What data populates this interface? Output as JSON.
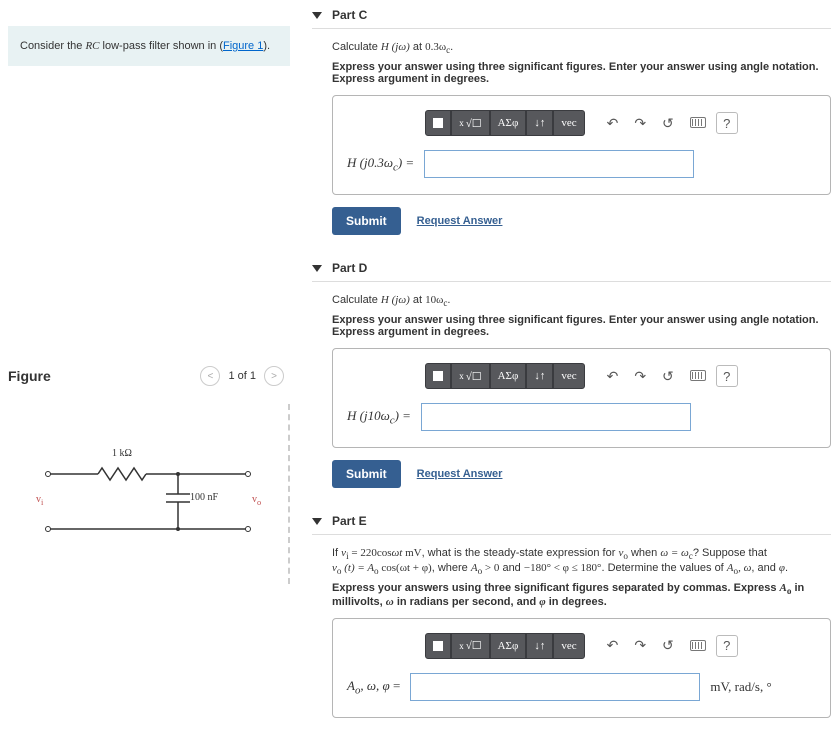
{
  "prompt": {
    "prefix": "Consider the ",
    "var": "RC",
    "mid": " low-pass filter shown in (",
    "figlink": "Figure 1",
    "suffix": ")."
  },
  "figure": {
    "heading": "Figure",
    "page": "1 of 1",
    "r_label": "1 kΩ",
    "c_label": "100 nF",
    "vi": "v",
    "vi_sub": "i",
    "vo": "v",
    "vo_sub": "o"
  },
  "tool": {
    "root": "√☐",
    "greek": "ΑΣφ",
    "arrows": "↓↑",
    "vec": "vec",
    "undo": "↶",
    "redo": "↷",
    "reset": "↺",
    "help": "?"
  },
  "common": {
    "submit": "Submit",
    "request": "Request Answer"
  },
  "partC": {
    "title": "Part C",
    "line1a": "Calculate ",
    "line1b": "H (jω)",
    "line1c": " at ",
    "line1d": "0.3ω",
    "line1d_sub": "c",
    "line1e": ".",
    "instr": "Express your answer using three significant figures. Enter your answer using angle notation. Express argument in degrees.",
    "label_a": "H (j0.3ω",
    "label_sub": "c",
    "label_b": ") ="
  },
  "partD": {
    "title": "Part D",
    "line1a": "Calculate ",
    "line1b": "H (jω)",
    "line1c": " at ",
    "line1d": "10ω",
    "line1d_sub": "c",
    "line1e": ".",
    "instr": "Express your answer using three significant figures. Enter your answer using angle notation. Express argument in degrees.",
    "label_a": "H (j10ω",
    "label_sub": "c",
    "label_b": ") ="
  },
  "partE": {
    "title": "Part E",
    "p1_a": "If ",
    "p1_b": "v",
    "p1_b_sub": "i",
    "p1_c": " = 220cos",
    "p1_d": "ωt",
    "p1_e": " mV",
    "p1_f": ", what is the steady-state expression for ",
    "p1_g": "v",
    "p1_g_sub": "o",
    "p1_h": " when ",
    "p1_i": "ω = ω",
    "p1_i_sub": "c",
    "p1_j": "? Suppose that ",
    "p2_a": "v",
    "p2_a_sub": "o",
    "p2_b": " (t) = A",
    "p2_b_sub": "o",
    "p2_c": " cos(ωt + φ)",
    "p2_d": ", where ",
    "p2_e": "A",
    "p2_e_sub": "o",
    "p2_f": " > 0",
    "p2_g": " and ",
    "p2_h": "−180° < φ ≤ 180°",
    "p2_i": ". Determine the values of ",
    "p2_j": "A",
    "p2_j_sub": "o",
    "p2_k": ", ω",
    "p2_l": ", and ",
    "p2_m": "φ",
    "p2_n": ".",
    "instr_a": "Express your answers using three significant figures separated by commas. Express ",
    "instr_b": "A",
    "instr_b_sub": "o",
    "instr_c": " in millivolts, ",
    "instr_d": "ω",
    "instr_e": " in radians per second, and ",
    "instr_f": "φ",
    "instr_g": " in degrees.",
    "label_a": "A",
    "label_a_sub": "o",
    "label_b": ", ω, φ",
    "label_c": " =",
    "units": "mV, rad/s, °"
  }
}
